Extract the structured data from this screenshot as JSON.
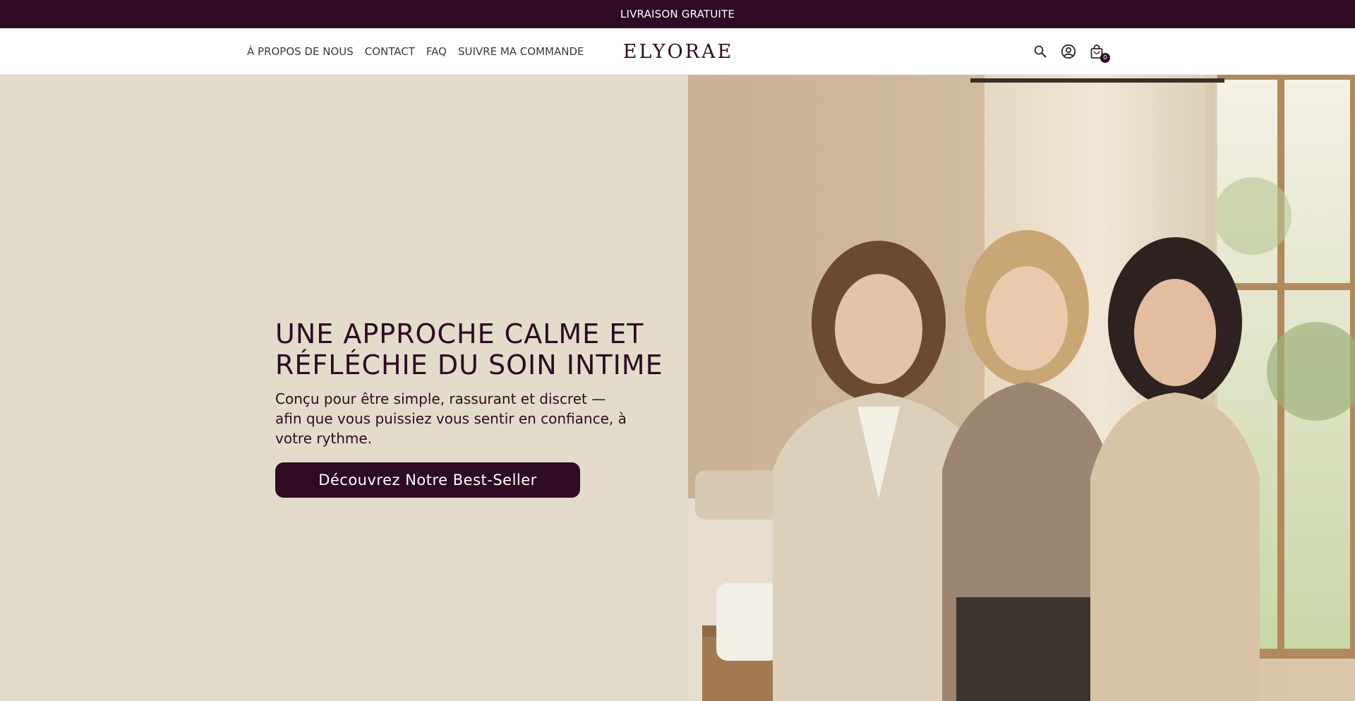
{
  "announcement": {
    "text": "LIVRAISON GRATUITE"
  },
  "nav": {
    "items": [
      {
        "label": "À PROPOS DE NOUS"
      },
      {
        "label": "CONTACT"
      },
      {
        "label": "FAQ"
      },
      {
        "label": "SUIVRE MA COMMANDE"
      }
    ]
  },
  "brand": {
    "logo": "ELYORAE"
  },
  "header_icons": {
    "search": "search-icon",
    "account": "account-icon",
    "cart": "cart-icon",
    "cart_count": "0"
  },
  "hero": {
    "title": "UNE APPROCHE CALME ET RÉFLÉCHIE DU SOIN INTIME",
    "subtitle": "Conçu pour être simple, rassurant et discret — afin que vous puissiez vous sentir en confiance, à votre rythme.",
    "cta_label": "Découvrez Notre Best-Seller"
  },
  "colors": {
    "brand": "#2e0a24",
    "hero_background": "#e3dccb",
    "text_dark": "#3a3a3a"
  }
}
